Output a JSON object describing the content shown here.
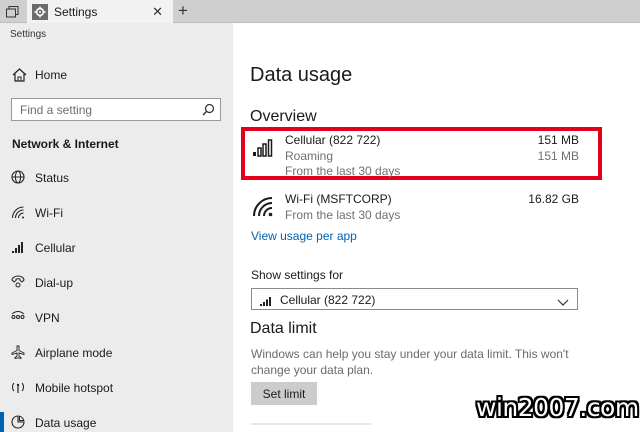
{
  "window": {
    "tab_title": "Settings",
    "close_glyph": "✕",
    "new_tab_glyph": "+"
  },
  "sidebar": {
    "app_title": "Settings",
    "home_label": "Home",
    "search_placeholder": "Find a setting",
    "section_title": "Network & Internet",
    "items": [
      {
        "label": "Status",
        "icon": "globe-icon"
      },
      {
        "label": "Wi-Fi",
        "icon": "wifi-icon"
      },
      {
        "label": "Cellular",
        "icon": "cellular-icon"
      },
      {
        "label": "Dial-up",
        "icon": "dialup-icon"
      },
      {
        "label": "VPN",
        "icon": "vpn-icon"
      },
      {
        "label": "Airplane mode",
        "icon": "airplane-icon"
      },
      {
        "label": "Mobile hotspot",
        "icon": "hotspot-icon"
      },
      {
        "label": "Data usage",
        "icon": "data-usage-icon",
        "selected": true
      }
    ]
  },
  "main": {
    "title": "Data usage",
    "overview_heading": "Overview",
    "connections": [
      {
        "name": "Cellular (822 722)",
        "amount": "151 MB",
        "status": "Roaming",
        "status_amount": "151 MB",
        "period": "From the last 30 days",
        "icon": "cellular-signal-icon"
      },
      {
        "name": "Wi-Fi (MSFTCORP)",
        "amount": "16.82 GB",
        "period": "From the last 30 days",
        "icon": "wifi-signal-icon"
      }
    ],
    "view_usage_link": "View usage per app",
    "show_settings_label": "Show settings for",
    "show_settings_value": "Cellular (822 722)",
    "data_limit_heading": "Data limit",
    "data_limit_desc": "Windows can help you stay under your data limit. This won't change your data plan.",
    "set_limit_button": "Set limit"
  },
  "colors": {
    "accent": "#0063b1",
    "highlight": "#e3001b",
    "sidebar_bg": "#ececec"
  },
  "watermark": "win2007.com"
}
